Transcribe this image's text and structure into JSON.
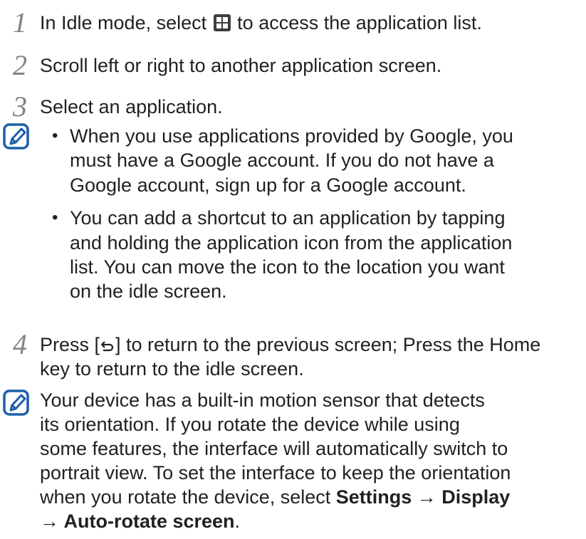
{
  "steps": [
    {
      "num": "1",
      "before": "In Idle mode, select",
      "after": "to access the application list."
    },
    {
      "num": "2",
      "text": "Scroll left or right to another application screen."
    },
    {
      "num": "3",
      "text": "Select an application."
    },
    {
      "num": "4",
      "line1_before": "Press [",
      "line1_after": "] to return to the previous screen; Press the Home",
      "line2": "key to return to the idle screen."
    }
  ],
  "note1": {
    "bullet1": [
      "When you use applications provided by Google, you",
      "must have a Google account. If you do not have a",
      "Google account, sign up for a Google account."
    ],
    "bullet2": [
      "You can add a shortcut to an application by tapping",
      "and holding the application icon from the application",
      "list. You can move the icon to the location you want",
      "on the idle screen."
    ]
  },
  "note2": {
    "lines": [
      "Your device has a built-in motion sensor that detects",
      "its orientation. If you rotate the device while using",
      "some features, the interface will automatically switch to",
      "portrait view. To set the interface to keep the orientation"
    ],
    "line5_before": "when you rotate the device, select ",
    "settings": "Settings",
    "arrow": " → ",
    "display": "Display",
    "line6_arrow": "→ ",
    "auto_rotate": "Auto-rotate screen",
    "period": "."
  },
  "icons": {
    "bullet": "•",
    "note": "note-pen-icon",
    "apps": "apps-grid-icon",
    "back": "back-arrow-icon"
  }
}
